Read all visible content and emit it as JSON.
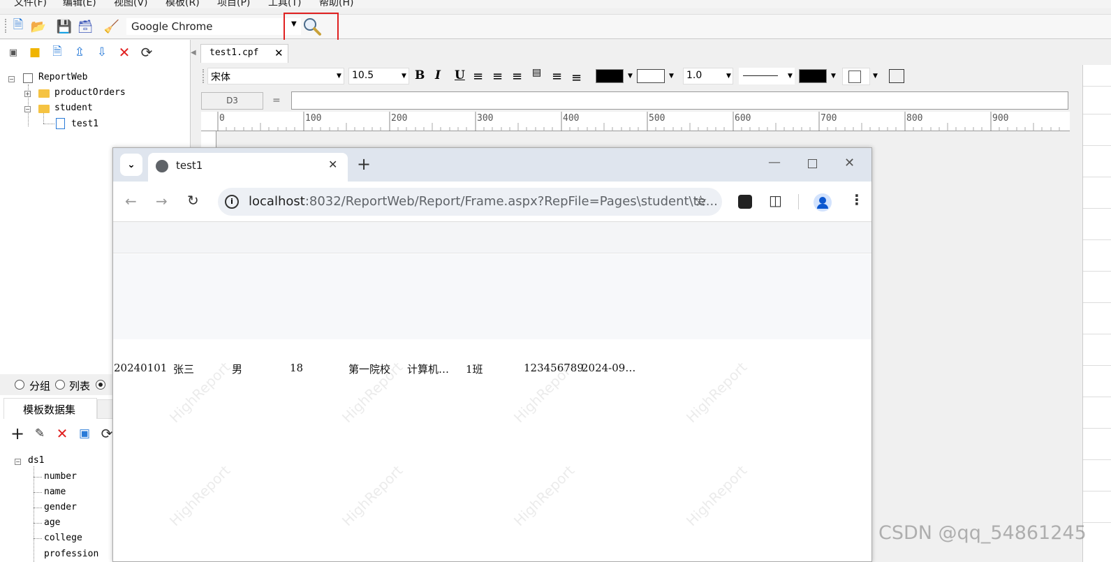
{
  "menu": [
    "文件(F)",
    "编辑(E)",
    "视图(V)",
    "模板(R)",
    "项目(P)",
    "工具(T)",
    "帮助(H)"
  ],
  "toolbar": {
    "browser": "Google Chrome"
  },
  "project_tree": {
    "root": "ReportWeb",
    "folders": [
      "productOrders",
      "student"
    ],
    "file": "test1"
  },
  "data_mode": {
    "options": [
      "分组",
      "列表"
    ],
    "tab": "模板数据集"
  },
  "dataset": {
    "name": "ds1",
    "fields": [
      "number",
      "name",
      "gender",
      "age",
      "college",
      "profession"
    ]
  },
  "editor": {
    "tab_label": "test1.cpf",
    "font": "宋体",
    "font_size": "10.5",
    "line_width": "1.0",
    "cell_ref": "D3",
    "equals": "=",
    "ruler_marks": [
      "0",
      "100",
      "200",
      "300",
      "400",
      "500",
      "600",
      "700",
      "800",
      "900"
    ]
  },
  "chrome": {
    "tab_title": "test1",
    "url_host": "localhost",
    "url_rest": ":8032/ReportWeb/Report/Frame.aspx?RepFile=Pages\\student\\te..."
  },
  "report_row": [
    "20240101",
    "张三",
    "男",
    "18",
    "第一院校",
    "计算机…",
    "1班",
    "123456789",
    "2024-09…"
  ],
  "watermark": "HighReport",
  "footer_watermark": "CSDN @qq_54861245",
  "colors": {
    "highlight": "#e02020",
    "chrome_frame": "#dfe5ee",
    "omnibox": "#edf0f5"
  }
}
